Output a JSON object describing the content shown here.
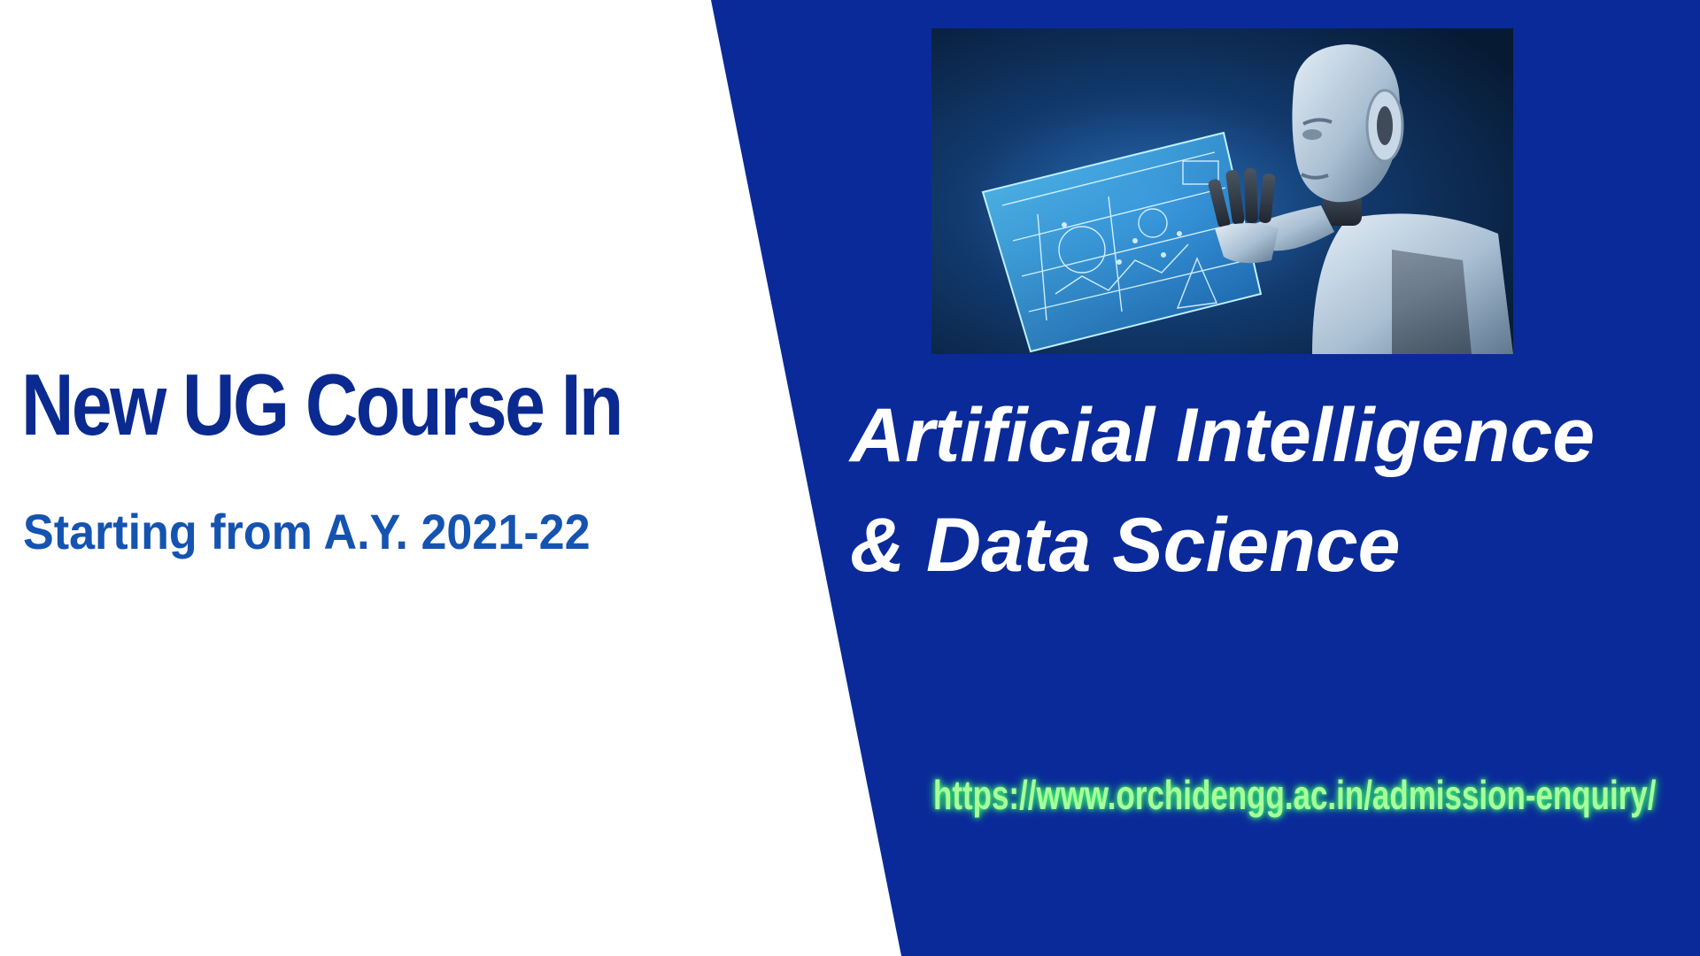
{
  "banner": {
    "headline": "New UG Course In",
    "subline": "Starting from A.Y. 2021-22",
    "course_line_1": "Artificial Intelligence",
    "course_line_2": "& Data Science",
    "url": "https://www.orchidengg.ac.in/admission-enquiry/"
  },
  "image": {
    "subject": "humanoid robot holding a holographic data screen"
  },
  "colors": {
    "background_left": "#ffffff",
    "background_right": "#0a2a9a",
    "headline": "#0a2a90",
    "subline": "#1553b0",
    "course_title": "#ffffff",
    "url": "#a8ff9c",
    "url_glow": "#3cff6a"
  }
}
